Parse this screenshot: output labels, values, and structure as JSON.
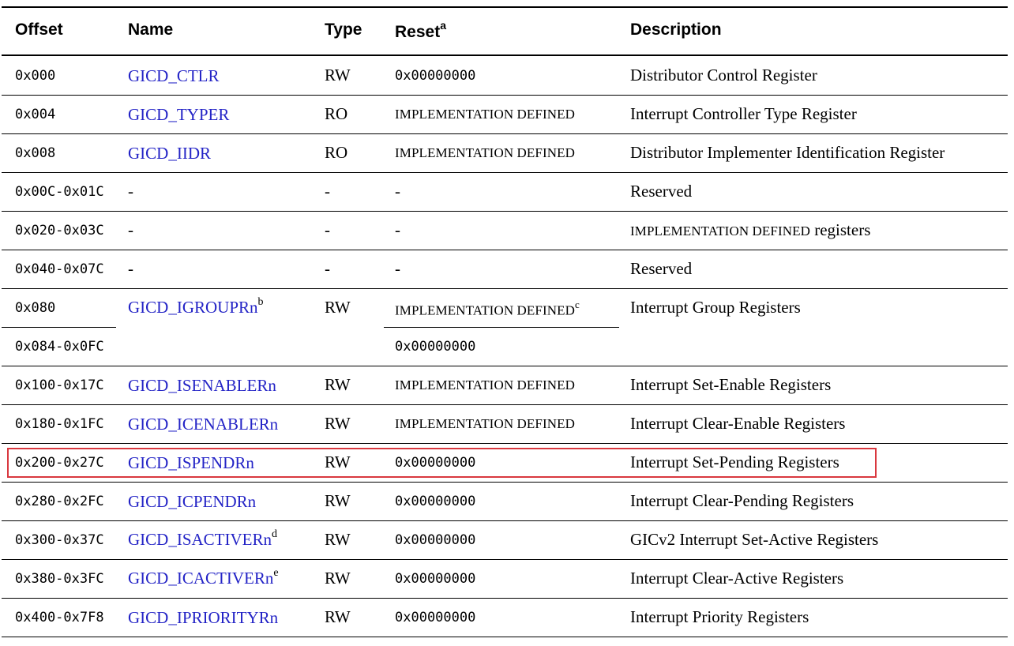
{
  "headers": {
    "offset": "Offset",
    "name": "Name",
    "type": "Type",
    "reset": "Reset",
    "reset_note": "a",
    "description": "Description"
  },
  "rows": [
    {
      "offset": "0x000",
      "name": "GICD_CTLR",
      "name_note": "",
      "type": "RW",
      "reset": "0x00000000",
      "reset_style": "mono",
      "reset_note": "",
      "description": "Distributor Control Register"
    },
    {
      "offset": "0x004",
      "name": "GICD_TYPER",
      "name_note": "",
      "type": "RO",
      "reset": "IMPLEMENTATION DEFINED",
      "reset_style": "impl",
      "reset_note": "",
      "description": "Interrupt Controller Type Register"
    },
    {
      "offset": "0x008",
      "name": "GICD_IIDR",
      "name_note": "",
      "type": "RO",
      "reset": "IMPLEMENTATION DEFINED",
      "reset_style": "impl",
      "reset_note": "",
      "description": "Distributor Implementer Identification Register"
    },
    {
      "offset": "0x00C-0x01C",
      "name": "-",
      "name_note": "",
      "type": "-",
      "reset": "-",
      "reset_style": "serif",
      "reset_note": "",
      "description": "Reserved"
    },
    {
      "offset": "0x020-0x03C",
      "name": "-",
      "name_note": "",
      "type": "-",
      "reset": "-",
      "reset_style": "serif",
      "reset_note": "",
      "description_impl": "IMPLEMENTATION DEFINED",
      "description": " registers"
    },
    {
      "offset": "0x040-0x07C",
      "name": "-",
      "name_note": "",
      "type": "-",
      "reset": "-",
      "reset_style": "serif",
      "reset_note": "",
      "description": "Reserved"
    },
    {
      "offset": "0x080",
      "offset2": "0x084-0x0FC",
      "name": "GICD_IGROUPRn",
      "name_note": "b",
      "type": "RW",
      "reset": "IMPLEMENTATION DEFINED",
      "reset_note": "c",
      "reset2": "0x00000000",
      "description": "Interrupt Group Registers"
    },
    {
      "offset": "0x100-0x17C",
      "name": "GICD_ISENABLERn",
      "name_note": "",
      "type": "RW",
      "reset": "IMPLEMENTATION DEFINED",
      "reset_style": "impl",
      "reset_note": "",
      "description": "Interrupt Set-Enable Registers"
    },
    {
      "offset": "0x180-0x1FC",
      "name": "GICD_ICENABLERn",
      "name_note": "",
      "type": "RW",
      "reset": "IMPLEMENTATION DEFINED",
      "reset_style": "impl",
      "reset_note": "",
      "description": "Interrupt Clear-Enable Registers"
    },
    {
      "offset": "0x200-0x27C",
      "name": "GICD_ISPENDRn",
      "name_note": "",
      "type": "RW",
      "reset": "0x00000000",
      "reset_style": "mono",
      "reset_note": "",
      "description": "Interrupt Set-Pending Registers",
      "highlighted": true
    },
    {
      "offset": "0x280-0x2FC",
      "name": "GICD_ICPENDRn",
      "name_note": "",
      "type": "RW",
      "reset": "0x00000000",
      "reset_style": "mono",
      "reset_note": "",
      "description": "Interrupt Clear-Pending Registers"
    },
    {
      "offset": "0x300-0x37C",
      "name": "GICD_ISACTIVERn",
      "name_note": "d",
      "type": "RW",
      "reset": "0x00000000",
      "reset_style": "mono",
      "reset_note": "",
      "description": "GICv2 Interrupt Set-Active Registers"
    },
    {
      "offset": "0x380-0x3FC",
      "name": "GICD_ICACTIVERn",
      "name_note": "e",
      "type": "RW",
      "reset": "0x00000000",
      "reset_style": "mono",
      "reset_note": "",
      "description": "Interrupt Clear-Active Registers"
    },
    {
      "offset": "0x400-0x7F8",
      "name": "GICD_IPRIORITYRn",
      "name_note": "",
      "type": "RW",
      "reset": "0x00000000",
      "reset_style": "mono",
      "reset_note": "",
      "description": "Interrupt Priority Registers"
    }
  ],
  "colors": {
    "link": "#2323c6",
    "highlight_border": "#d9383f"
  }
}
